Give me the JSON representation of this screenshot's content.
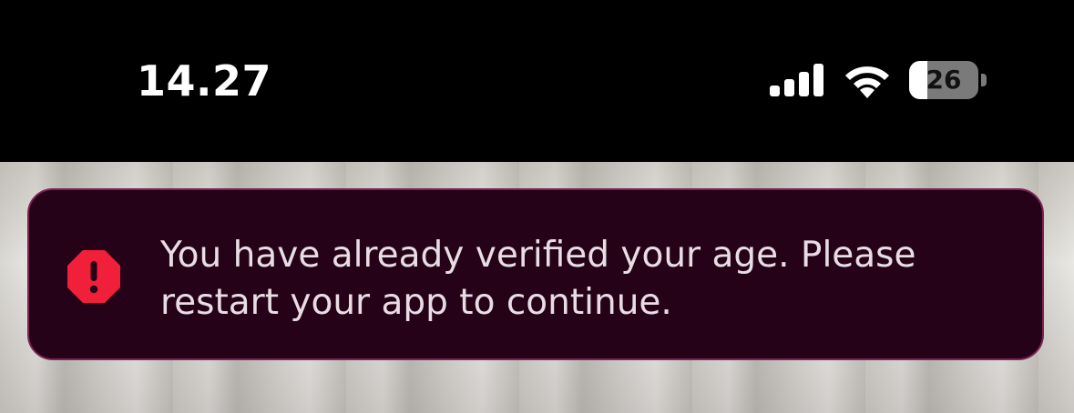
{
  "status_bar": {
    "time": "14.27",
    "battery_level": 26,
    "battery_label": "26",
    "icons": [
      "cellular-signal-icon",
      "wifi-icon",
      "battery-icon"
    ]
  },
  "toast": {
    "icon": "error-octagon-icon",
    "message": "You have already verified your age. Please\nrestart your app to continue.",
    "colors": {
      "background": "#250217",
      "border": "#7a2452",
      "icon": "#f0203a",
      "text": "#e8dde4"
    }
  }
}
